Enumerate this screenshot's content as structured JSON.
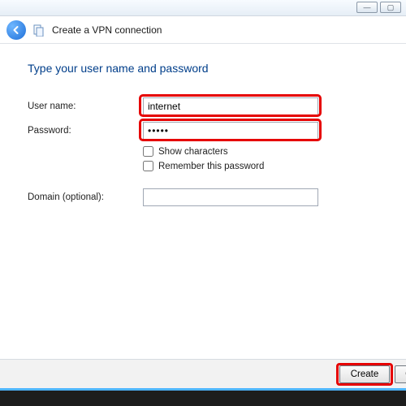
{
  "window": {
    "title": "Create a VPN connection",
    "minimize_glyph": "—",
    "maximize_glyph": "▢"
  },
  "headline": "Type your user name and password",
  "labels": {
    "username": "User name:",
    "password": "Password:",
    "show_chars": "Show characters",
    "remember": "Remember this password",
    "domain": "Domain (optional):"
  },
  "fields": {
    "username_value": "internet",
    "password_masked": "•••••",
    "domain_value": ""
  },
  "buttons": {
    "create": "Create",
    "cancel": "Cancel"
  },
  "colors": {
    "accent": "#003e8a",
    "highlight": "#e60000"
  }
}
